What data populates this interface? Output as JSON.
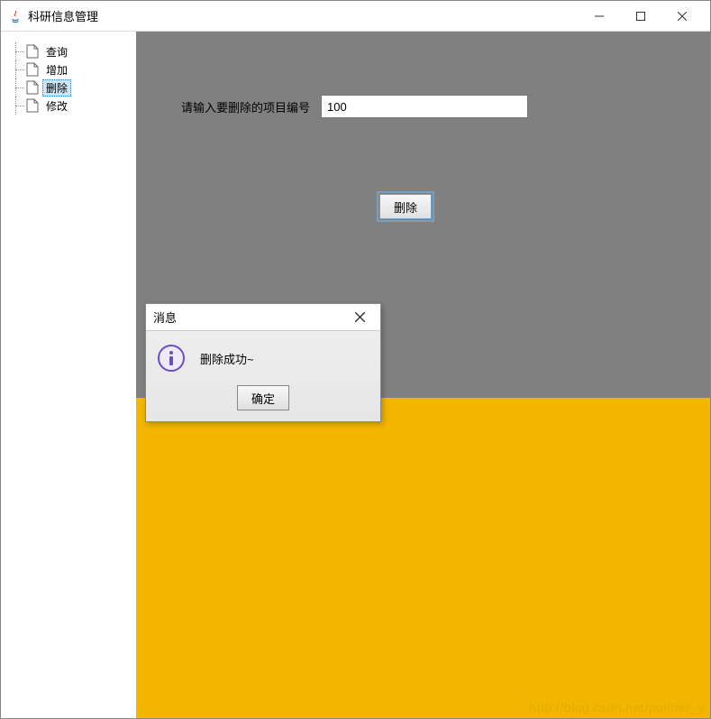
{
  "window": {
    "title": "科研信息管理"
  },
  "sidebar": {
    "items": [
      {
        "label": "查询"
      },
      {
        "label": "增加"
      },
      {
        "label": "删除",
        "selected": true
      },
      {
        "label": "修改"
      }
    ]
  },
  "main": {
    "input_label": "请输入要删除的项目编号",
    "input_value": "100",
    "delete_button": "删除"
  },
  "dialog": {
    "title": "消息",
    "message": "删除成功~",
    "ok_button": "确定"
  },
  "watermark": "http://blog.csdn.net/pointer_y"
}
